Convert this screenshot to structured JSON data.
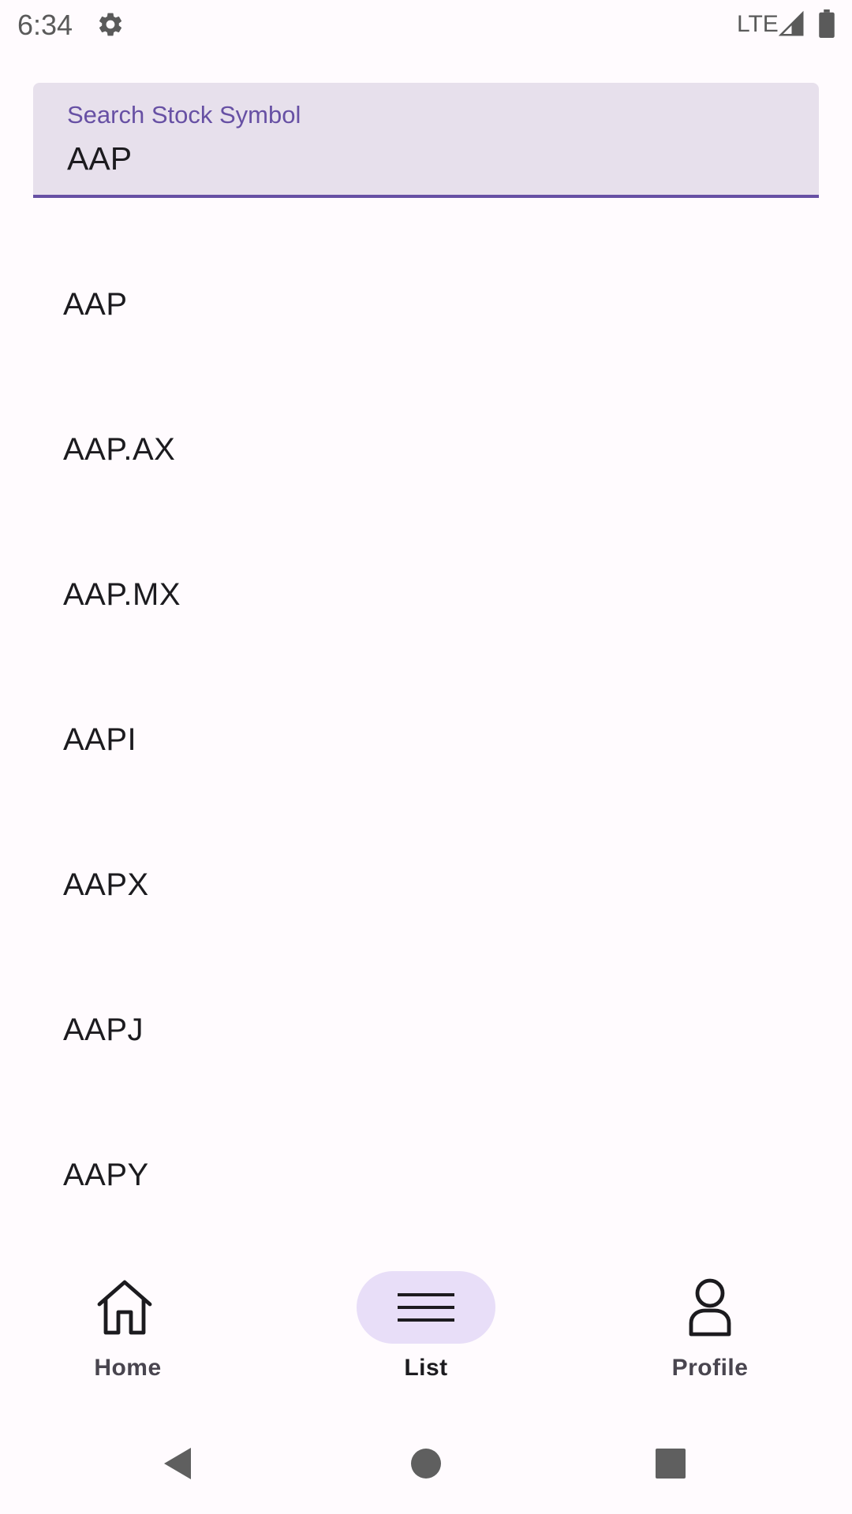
{
  "status_bar": {
    "time": "6:34",
    "network": "LTE",
    "settings_icon": "gear-icon",
    "signal_icon": "signal-icon",
    "battery_icon": "battery-icon"
  },
  "search": {
    "label": "Search Stock Symbol",
    "value": "AAP"
  },
  "results": [
    "AAP",
    "AAP.AX",
    "AAP.MX",
    "AAPI",
    "AAPX",
    "AAPJ",
    "AAPY"
  ],
  "bottom_nav": {
    "items": [
      {
        "label": "Home",
        "icon": "home-icon",
        "selected": false
      },
      {
        "label": "List",
        "icon": "list-icon",
        "selected": true
      },
      {
        "label": "Profile",
        "icon": "profile-icon",
        "selected": false
      }
    ]
  },
  "system_nav": {
    "back_icon": "back-icon",
    "home_icon": "home-circle-icon",
    "recents_icon": "recents-icon"
  },
  "colors": {
    "background": "#fffbfe",
    "accent": "#6750a4",
    "field_background": "#e7e0ec",
    "nav_indicator": "#e8def8",
    "text": "#1c1b1f"
  }
}
